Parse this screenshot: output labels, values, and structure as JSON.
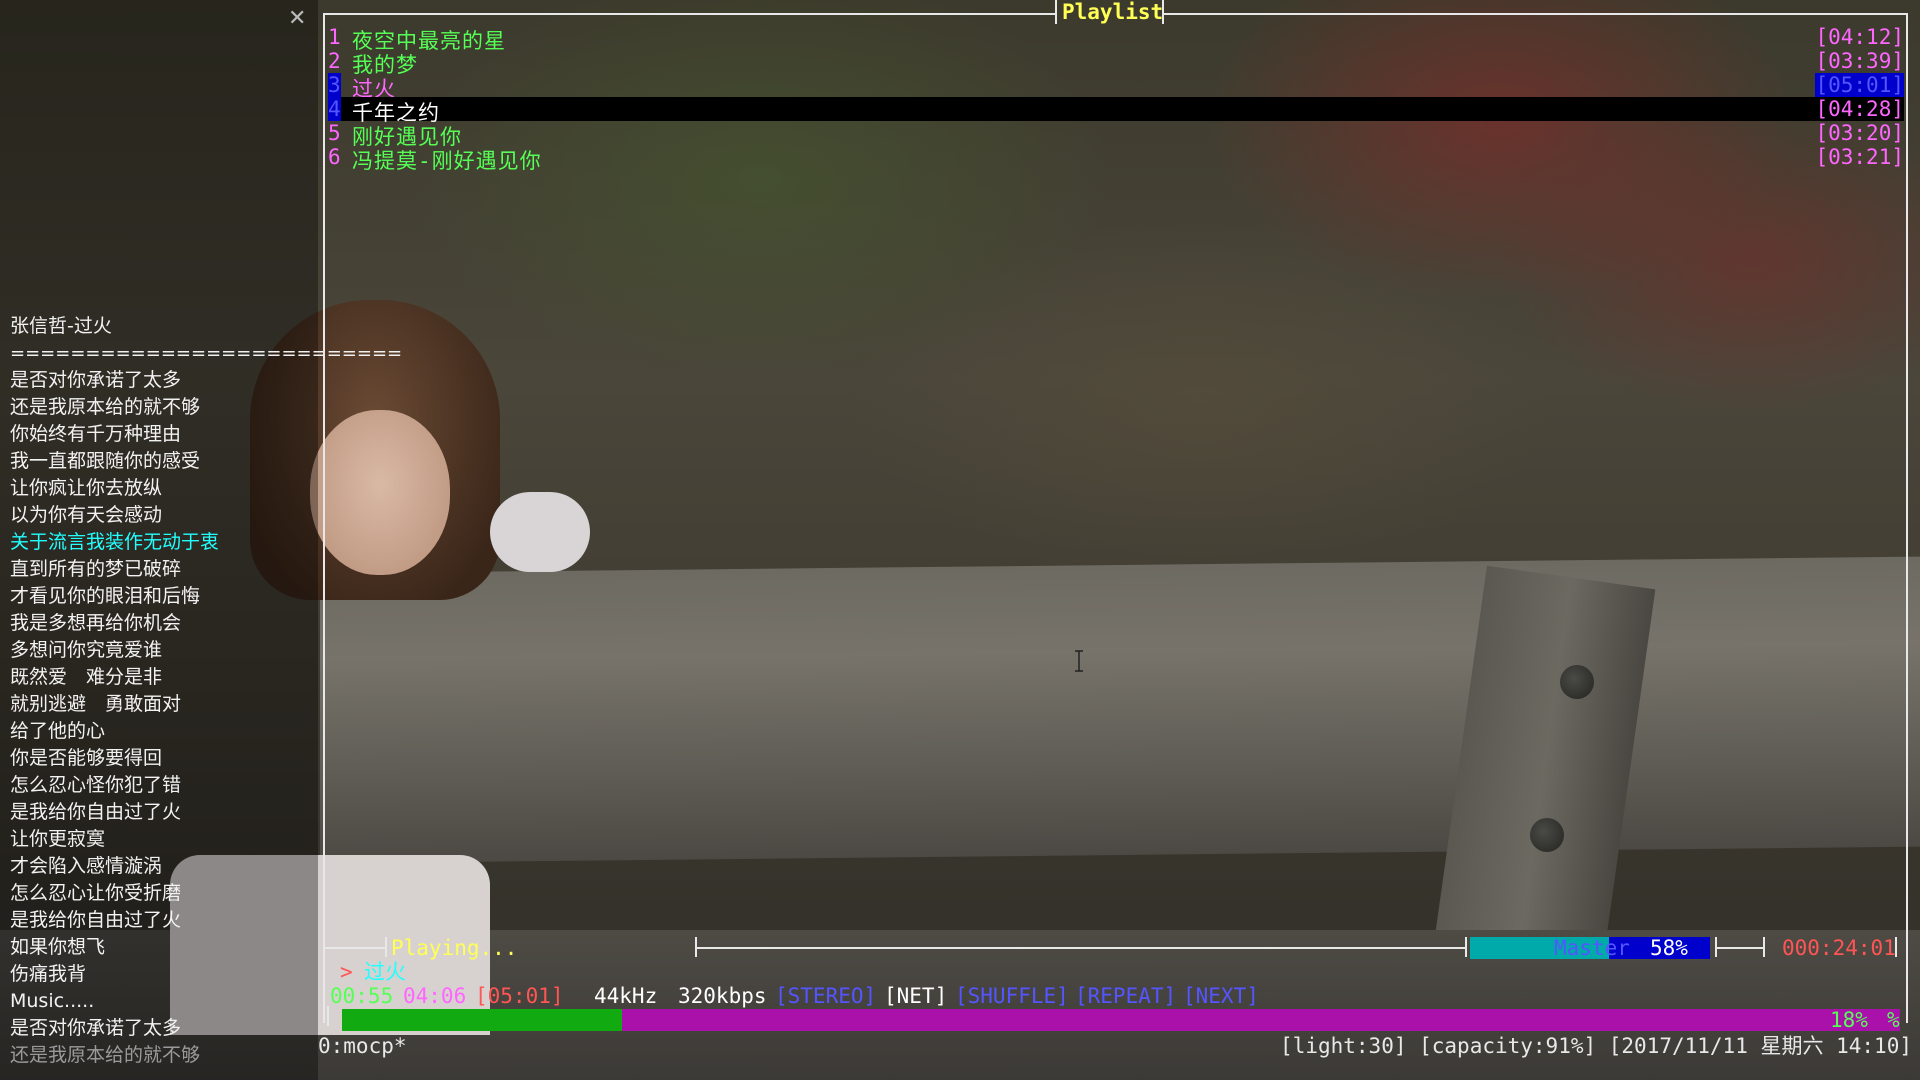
{
  "lyrics": {
    "title": "张信哲-过火",
    "separator": "==========================",
    "lines": [
      "是否对你承诺了太多",
      "还是我原本给的就不够",
      "你始终有千万种理由",
      "我一直都跟随你的感受",
      "让你疯让你去放纵",
      "以为你有天会感动",
      "关于流言我装作无动于衷",
      "直到所有的梦已破碎",
      "才看见你的眼泪和后悔",
      "我是多想再给你机会",
      "多想问你究竟爱谁",
      "既然爱　难分是非",
      "就别逃避　勇敢面对",
      "给了他的心",
      "你是否能够要得回",
      "怎么忍心怪你犯了错",
      "是我给你自由过了火",
      "让你更寂寞",
      "才会陷入感情漩涡",
      "怎么忍心让你受折磨",
      "是我给你自由过了火",
      "如果你想飞",
      "伤痛我背",
      "Music.....",
      "是否对你承诺了太多",
      "还是我原本给的就不够"
    ],
    "highlight_index": 6
  },
  "playlist": {
    "header": "Playlist",
    "items": [
      {
        "num": "1",
        "title": "夜空中最亮的星",
        "time": "[04:12]"
      },
      {
        "num": "2",
        "title": "我的梦",
        "time": "[03:39]"
      },
      {
        "num": "3",
        "title": "过火",
        "time": "[05:01]"
      },
      {
        "num": "4",
        "title": "千年之约",
        "time": "[04:28]"
      },
      {
        "num": "5",
        "title": "刚好遇见你",
        "time": "[03:20]"
      },
      {
        "num": "6",
        "title": "冯提莫-刚好遇见你",
        "time": "[03:21]"
      }
    ]
  },
  "player": {
    "state": "Playing...",
    "mixer_label": "Master",
    "mixer_value": "58%",
    "total_time": "000:24:01",
    "current_prefix": ">",
    "current_title": "过火",
    "elapsed": "00:55",
    "remaining": "04:06",
    "duration": "[05:01]",
    "rate": "44kHz",
    "bitrate": "320kbps",
    "flags": [
      "[STEREO]",
      "[NET]",
      "[SHUFFLE]",
      "[REPEAT]",
      "[NEXT]"
    ],
    "progress_fraction": 0.18,
    "progress_label": "18%",
    "progress_suffix": "%"
  },
  "tmux": {
    "window": "0:mocp*",
    "status_right": "[light:30] [capacity:91%] [2017/11/11 星期六 14:10]"
  },
  "colors": {
    "magenta": "#ff66ff",
    "green": "#55ff55",
    "yellow": "#ffff55",
    "cyan": "#22ffff",
    "blue": "#5555ff",
    "red": "#ff5555",
    "progress_green": "#11aa11",
    "progress_magenta": "#aa11aa"
  }
}
